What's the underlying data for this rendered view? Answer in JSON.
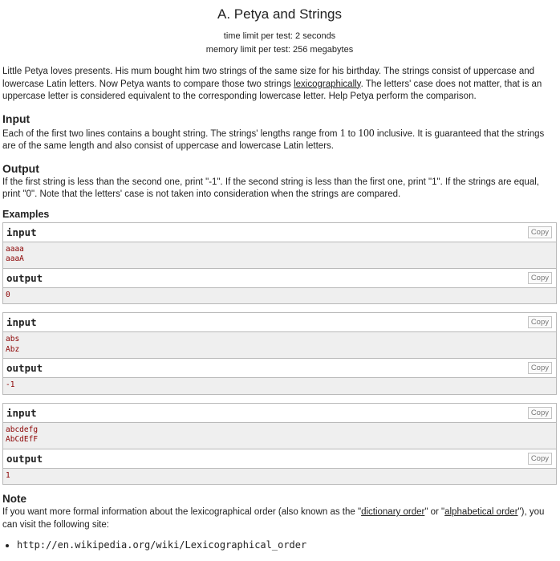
{
  "problem": {
    "title": "A. Petya and Strings",
    "time_limit": "time limit per test: 2 seconds",
    "memory_limit": "memory limit per test: 256 megabytes"
  },
  "legend": {
    "part1": "Little Petya loves presents. His mum bought him two strings of the same size for his birthday. The strings consist of uppercase and lowercase Latin letters. Now Petya wants to compare those two strings ",
    "link": "lexicographically",
    "part2": ". The letters' case does not matter, that is an uppercase letter is considered equivalent to the corresponding lowercase letter. Help Petya perform the comparison."
  },
  "input_spec": {
    "title": "Input",
    "part1": "Each of the first two lines contains a bought string. The strings' lengths range from ",
    "min": "1",
    "mid": " to ",
    "max": "100",
    "part2": " inclusive. It is guaranteed that the strings are of the same length and also consist of uppercase and lowercase Latin letters."
  },
  "output_spec": {
    "title": "Output",
    "text": "If the first string is less than the second one, print \"-1\". If the second string is less than the first one, print \"1\". If the strings are equal, print \"0\". Note that the letters' case is not taken into consideration when the strings are compared."
  },
  "examples": {
    "title": "Examples",
    "input_label": "input",
    "output_label": "output",
    "copy_label": "Copy",
    "samples": [
      {
        "input": [
          "aaaa",
          "aaaA"
        ],
        "output": [
          "0"
        ]
      },
      {
        "input": [
          "abs",
          "Abz"
        ],
        "output": [
          "-1"
        ]
      },
      {
        "input": [
          "abcdefg",
          "AbCdEfF"
        ],
        "output": [
          "1"
        ]
      }
    ]
  },
  "note": {
    "title": "Note",
    "part1": "If you want more formal information about the lexicographical order (also known as the \"",
    "link1": "dictionary order",
    "part2": "\" or \"",
    "link2": "alphabetical order",
    "part3": "\"), you can visit the following site:",
    "url": "http://en.wikipedia.org/wiki/Lexicographical_order"
  }
}
